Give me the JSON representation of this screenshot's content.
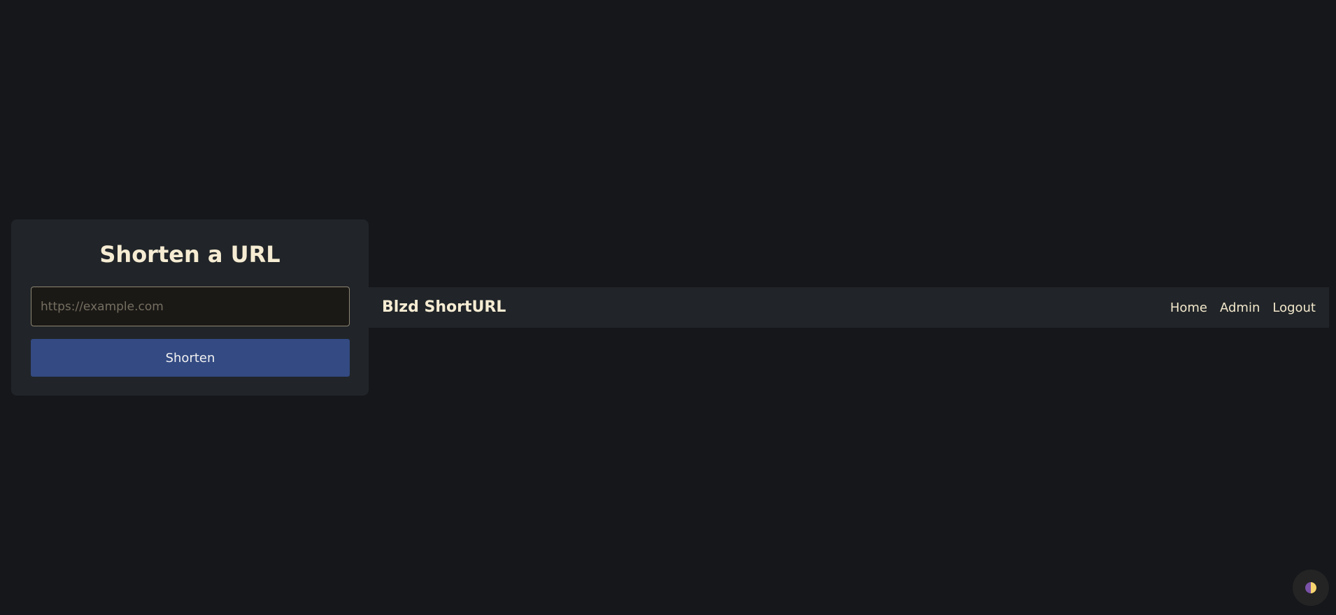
{
  "shorten_card": {
    "title": "Shorten a URL",
    "url_input": {
      "placeholder": "https://example.com",
      "value": ""
    },
    "submit_label": "Shorten"
  },
  "navbar": {
    "brand": "Blzd ShortURL",
    "links": [
      {
        "label": "Home"
      },
      {
        "label": "Admin"
      },
      {
        "label": "Logout"
      }
    ]
  },
  "theme_toggle": {
    "icon": "half-moon-theme-icon"
  },
  "colors": {
    "background": "#15171b",
    "surface": "#212529",
    "primary_button": "#334a82",
    "heading_text": "#f6ecd3",
    "input_border": "#8d8571"
  }
}
